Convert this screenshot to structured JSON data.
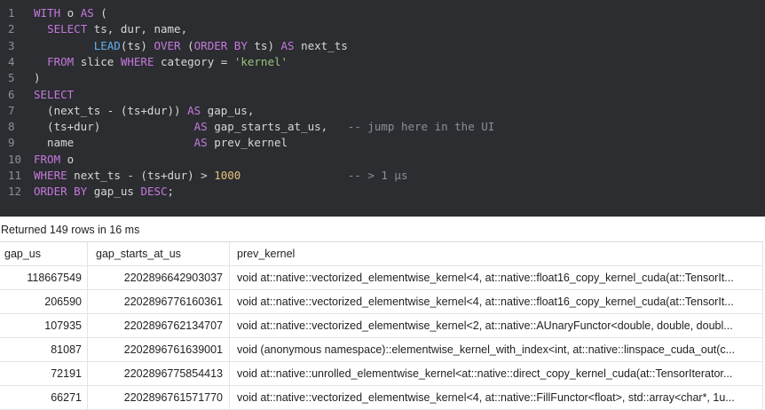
{
  "editor": {
    "line_numbers": [
      "1",
      "2",
      "3",
      "4",
      "5",
      "6",
      "7",
      "8",
      "9",
      "10",
      "11",
      "12"
    ],
    "lines": [
      [
        {
          "t": "WITH",
          "c": "kw"
        },
        {
          "t": " o "
        },
        {
          "t": "AS",
          "c": "kw"
        },
        {
          "t": " ("
        }
      ],
      [
        {
          "t": "  "
        },
        {
          "t": "SELECT",
          "c": "kw"
        },
        {
          "t": " ts, dur, name,"
        }
      ],
      [
        {
          "t": "         "
        },
        {
          "t": "LEAD",
          "c": "fn"
        },
        {
          "t": "(ts) "
        },
        {
          "t": "OVER",
          "c": "kw"
        },
        {
          "t": " ("
        },
        {
          "t": "ORDER BY",
          "c": "kw"
        },
        {
          "t": " ts) "
        },
        {
          "t": "AS",
          "c": "kw"
        },
        {
          "t": " next_ts"
        }
      ],
      [
        {
          "t": "  "
        },
        {
          "t": "FROM",
          "c": "kw"
        },
        {
          "t": " slice "
        },
        {
          "t": "WHERE",
          "c": "kw"
        },
        {
          "t": " category = "
        },
        {
          "t": "'kernel'",
          "c": "str"
        }
      ],
      [
        {
          "t": ")"
        }
      ],
      [
        {
          "t": "SELECT",
          "c": "kw"
        }
      ],
      [
        {
          "t": "  (next_ts - (ts+dur)) "
        },
        {
          "t": "AS",
          "c": "kw"
        },
        {
          "t": " gap_us,"
        }
      ],
      [
        {
          "t": "  (ts+dur)              "
        },
        {
          "t": "AS",
          "c": "kw"
        },
        {
          "t": " gap_starts_at_us,   "
        },
        {
          "t": "-- jump here in the UI",
          "c": "cmt"
        }
      ],
      [
        {
          "t": "  name                  "
        },
        {
          "t": "AS",
          "c": "kw"
        },
        {
          "t": " prev_kernel"
        }
      ],
      [
        {
          "t": "FROM",
          "c": "kw"
        },
        {
          "t": " o"
        }
      ],
      [
        {
          "t": "WHERE",
          "c": "kw"
        },
        {
          "t": " next_ts - (ts+dur) > "
        },
        {
          "t": "1000",
          "c": "num"
        },
        {
          "t": "                "
        },
        {
          "t": "-- > 1 µs",
          "c": "cmt"
        }
      ],
      [
        {
          "t": "ORDER BY",
          "c": "kw"
        },
        {
          "t": " gap_us "
        },
        {
          "t": "DESC",
          "c": "kw"
        },
        {
          "t": ";"
        }
      ]
    ]
  },
  "status": "Returned 149 rows in 16 ms",
  "columns": [
    "gap_us",
    "gap_starts_at_us",
    "prev_kernel"
  ],
  "rows": [
    [
      "118667549",
      "2202896642903037",
      "void at::native::vectorized_elementwise_kernel<4, at::native::float16_copy_kernel_cuda(at::TensorIt..."
    ],
    [
      "206590",
      "2202896776160361",
      "void at::native::vectorized_elementwise_kernel<4, at::native::float16_copy_kernel_cuda(at::TensorIt..."
    ],
    [
      "107935",
      "2202896762134707",
      "void at::native::vectorized_elementwise_kernel<2, at::native::AUnaryFunctor<double, double, doubl..."
    ],
    [
      "81087",
      "2202896761639001",
      "void (anonymous namespace)::elementwise_kernel_with_index<int, at::native::linspace_cuda_out(c..."
    ],
    [
      "72191",
      "2202896775854413",
      "void at::native::unrolled_elementwise_kernel<at::native::direct_copy_kernel_cuda(at::TensorIterator..."
    ],
    [
      "66271",
      "2202896761571770",
      "void at::native::vectorized_elementwise_kernel<4, at::native::FillFunctor<float>, std::array<char*, 1u..."
    ]
  ]
}
